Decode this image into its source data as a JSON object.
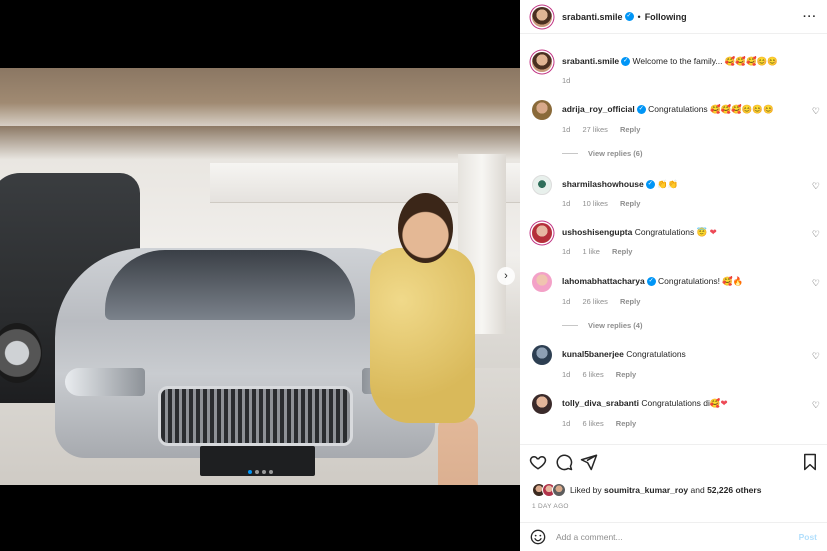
{
  "post": {
    "author": "srabanti.smile",
    "following_label": "Following",
    "dot_separator": "•",
    "more_icon": "more-horizontal-icon",
    "carousel": {
      "total": 4,
      "active": 0
    }
  },
  "caption": {
    "username": "srabanti.smile",
    "text": "Welcome to the family...",
    "emojis": "🥰🥰🥰😊😊",
    "time": "1d"
  },
  "comments": [
    {
      "username": "adrija_roy_official",
      "verified": true,
      "text": "Congratulations",
      "emojis": "🥰🥰🥰😊😊😊",
      "time": "1d",
      "likes": "27 likes",
      "reply": "Reply",
      "view_replies": "View replies (6)"
    },
    {
      "username": "sharmilashowhouse",
      "verified": true,
      "text": "",
      "emojis": "👏👏",
      "time": "1d",
      "likes": "10 likes",
      "reply": "Reply"
    },
    {
      "username": "ushoshisengupta",
      "verified": false,
      "text": "Congratulations",
      "emojis": "😇",
      "heart": "❤",
      "time": "1d",
      "likes": "1 like",
      "reply": "Reply"
    },
    {
      "username": "lahomabhattacharya",
      "verified": true,
      "text": "Congratulations!",
      "emojis": "🥰🔥",
      "time": "1d",
      "likes": "26 likes",
      "reply": "Reply",
      "view_replies": "View replies (4)"
    },
    {
      "username": "kunal5banerjee",
      "verified": false,
      "text": "Congratulations",
      "emojis": "",
      "time": "1d",
      "likes": "6 likes",
      "reply": "Reply"
    },
    {
      "username": "tolly_diva_srabanti",
      "verified": false,
      "text": "Congratulations di",
      "emojis": "🥰",
      "heart": "❤",
      "time": "1d",
      "likes": "6 likes",
      "reply": "Reply"
    }
  ],
  "actions": {
    "liked_by_prefix": "Liked by",
    "liked_by_user": "soumitra_kumar_roy",
    "and_label": "and",
    "others": "52,226 others",
    "date": "1 DAY AGO"
  },
  "add_comment": {
    "placeholder": "Add a comment...",
    "post_label": "Post"
  },
  "colors": {
    "verified": "#0095f6",
    "link": "#0095f6",
    "post_disabled": "#b2dffc",
    "muted": "#8e8e8e"
  }
}
